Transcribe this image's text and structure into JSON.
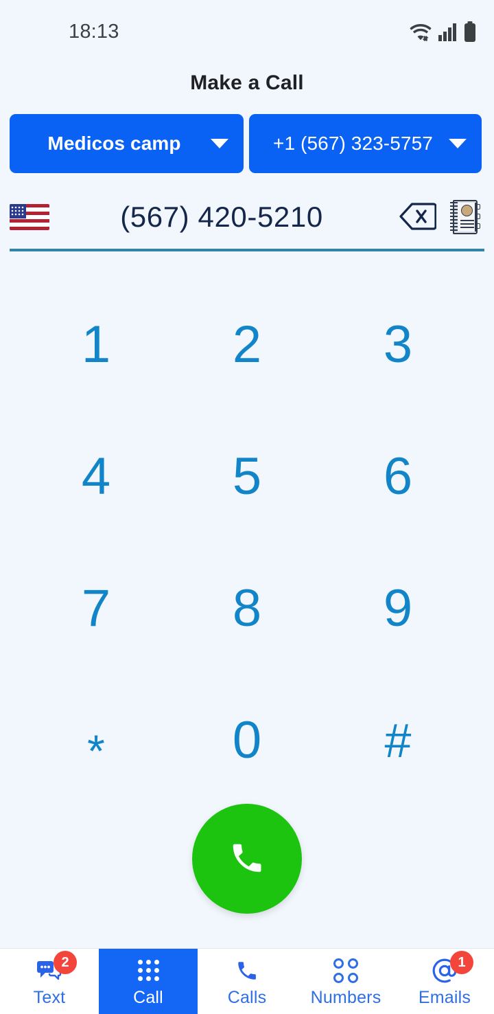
{
  "status_bar": {
    "time": "18:13",
    "icons": [
      "wifi-icon",
      "cellular-signal-icon",
      "battery-icon"
    ]
  },
  "header": {
    "title": "Make a Call"
  },
  "selectors": {
    "account": {
      "label": "Medicos camp",
      "icon": "chevron-down-icon"
    },
    "caller_id": {
      "label": "+1 (567) 323-5757",
      "icon": "chevron-down-icon"
    },
    "background_color": "#0a62f5"
  },
  "phone_input": {
    "country_flag": "us-flag-icon",
    "value": "(567) 420-5210",
    "backspace_icon": "backspace-icon",
    "contacts_icon": "address-book-icon",
    "underline_color": "#3284ad"
  },
  "keypad": {
    "keys": [
      "1",
      "2",
      "3",
      "4",
      "5",
      "6",
      "7",
      "8",
      "9",
      "*",
      "0",
      "#"
    ],
    "key_color": "#1285c8"
  },
  "call_button": {
    "icon": "phone-handset-icon",
    "color": "#1cc40f"
  },
  "bottom_nav": {
    "items": [
      {
        "label": "Text",
        "icon": "chat-bubbles-icon",
        "badge": "2",
        "active": false
      },
      {
        "label": "Call",
        "icon": "dial-pad-icon",
        "badge": null,
        "active": true
      },
      {
        "label": "Calls",
        "icon": "phone-handset-icon",
        "badge": null,
        "active": false
      },
      {
        "label": "Numbers",
        "icon": "four-circles-icon",
        "badge": null,
        "active": false
      },
      {
        "label": "Emails",
        "icon": "at-sign-icon",
        "badge": "1",
        "active": false
      }
    ],
    "active_color": "#1467f5",
    "badge_color": "#f4453c"
  }
}
